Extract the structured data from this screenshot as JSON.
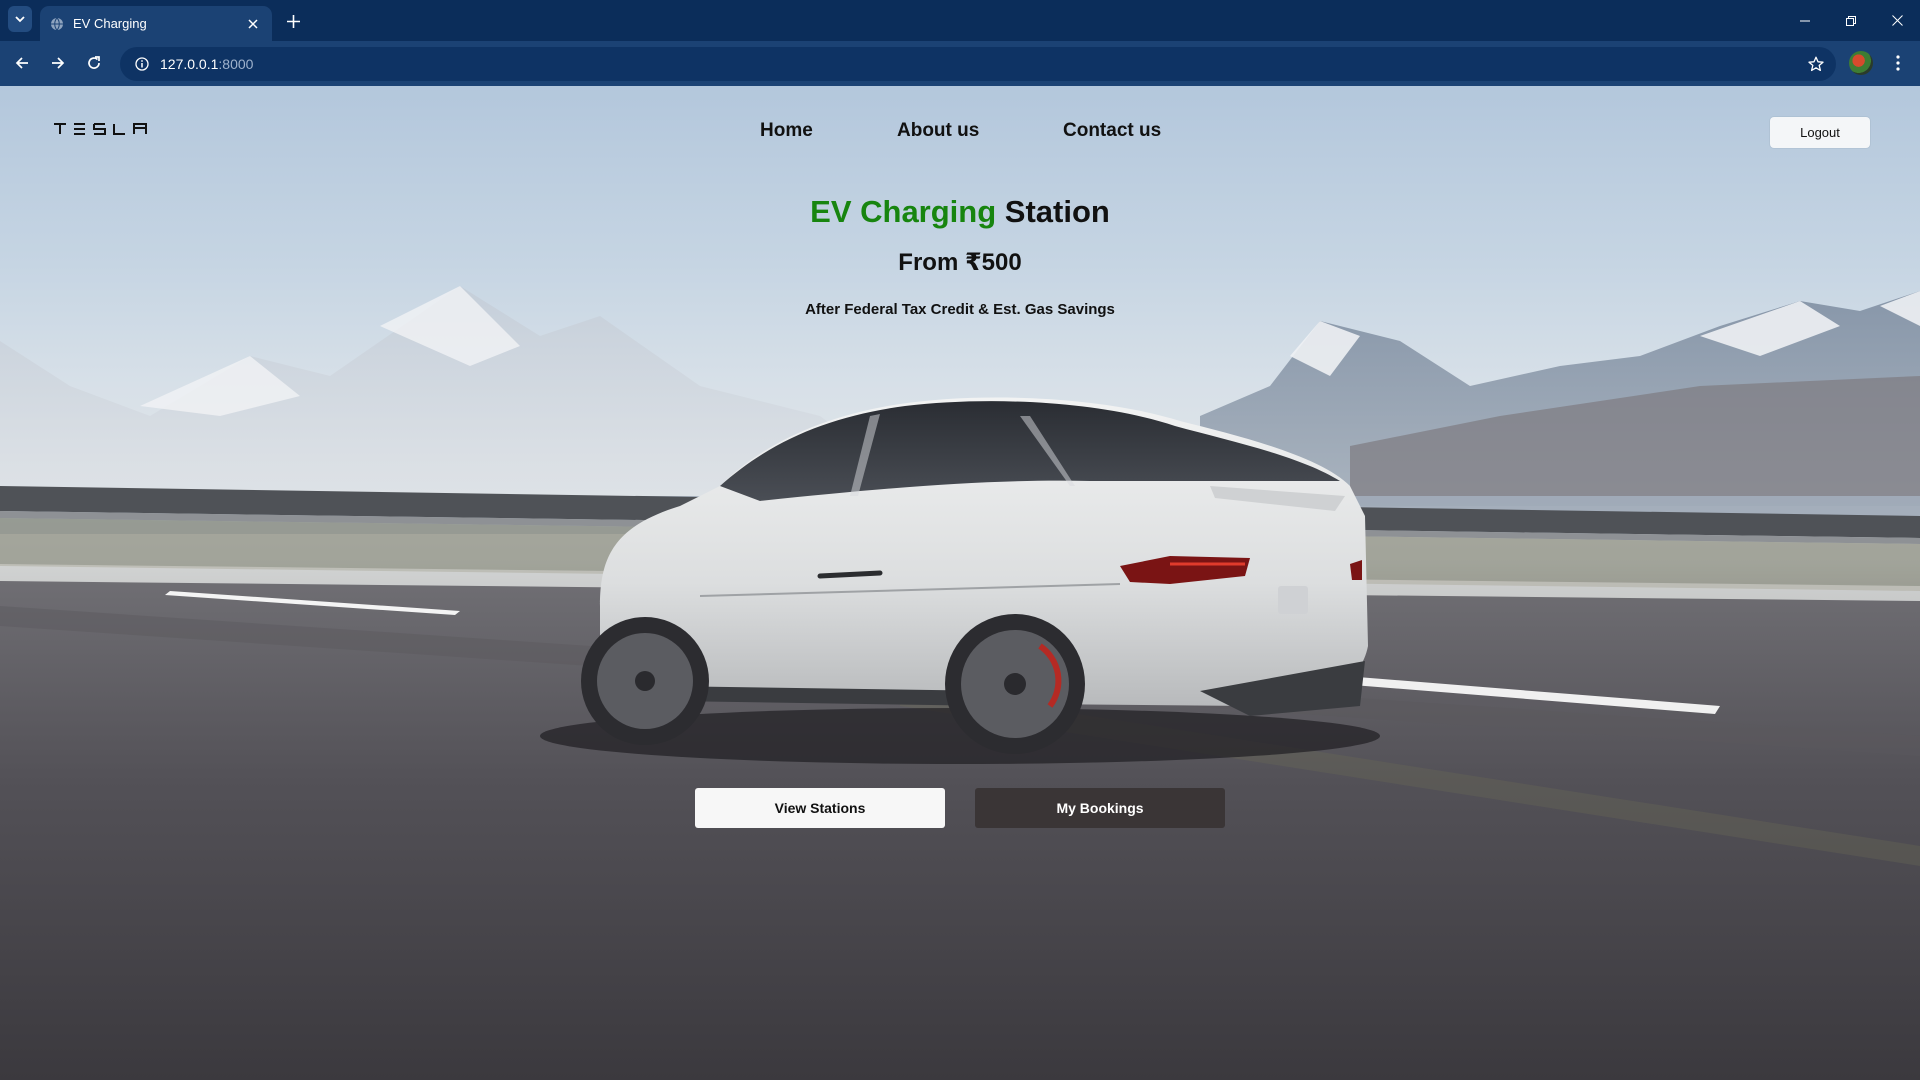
{
  "browser": {
    "tab_title": "EV Charging",
    "url_host": "127.0.0.1",
    "url_port": ":8000"
  },
  "page": {
    "logo_text": "TESLA",
    "nav": {
      "home": "Home",
      "about": "About us",
      "contact": "Contact us"
    },
    "logout_label": "Logout",
    "hero": {
      "title_highlight": "EV Charging",
      "title_rest": " Station",
      "price": "From ₹500",
      "subtitle": "After Federal Tax Credit & Est. Gas Savings"
    },
    "buttons": {
      "view_stations": "View Stations",
      "my_bookings": "My Bookings"
    }
  },
  "colors": {
    "chrome_dark": "#0b2d5a",
    "chrome_toolbar": "#1b4274",
    "title_green": "#17850f",
    "bookings_button": "#3a3536"
  },
  "icons": [
    "tab-list-icon",
    "globe-icon",
    "close-icon",
    "plus-icon",
    "minimize-icon",
    "restore-icon",
    "window-close-icon",
    "back-arrow-icon",
    "forward-arrow-icon",
    "reload-icon",
    "site-info-icon",
    "bookmark-star-icon",
    "profile-avatar",
    "more-menu-icon",
    "tesla-wordmark",
    "car-image"
  ]
}
